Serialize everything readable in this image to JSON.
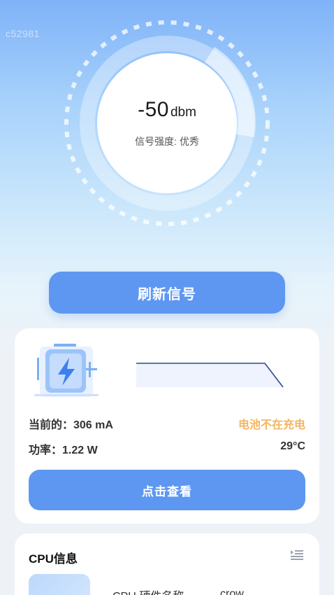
{
  "watermark": "c52981",
  "signal": {
    "value": "-50",
    "unit": "dbm",
    "strength_label": "信号强度:",
    "strength_value": "优秀"
  },
  "refresh_button": "刷新信号",
  "battery": {
    "current_label": "当前的：306 mA",
    "status": "电池不在充电",
    "power_label": "功率：1.22 W",
    "temperature": "29°C",
    "view_button": "点击查看"
  },
  "cpu": {
    "title": "CPU信息",
    "hw_name_label": "CPU 硬件名称",
    "hw_name_value": "crow"
  },
  "colors": {
    "accent": "#5e97f1",
    "warning": "#f3b562"
  },
  "icons": [
    "battery-charging-icon",
    "menu-list-icon"
  ]
}
